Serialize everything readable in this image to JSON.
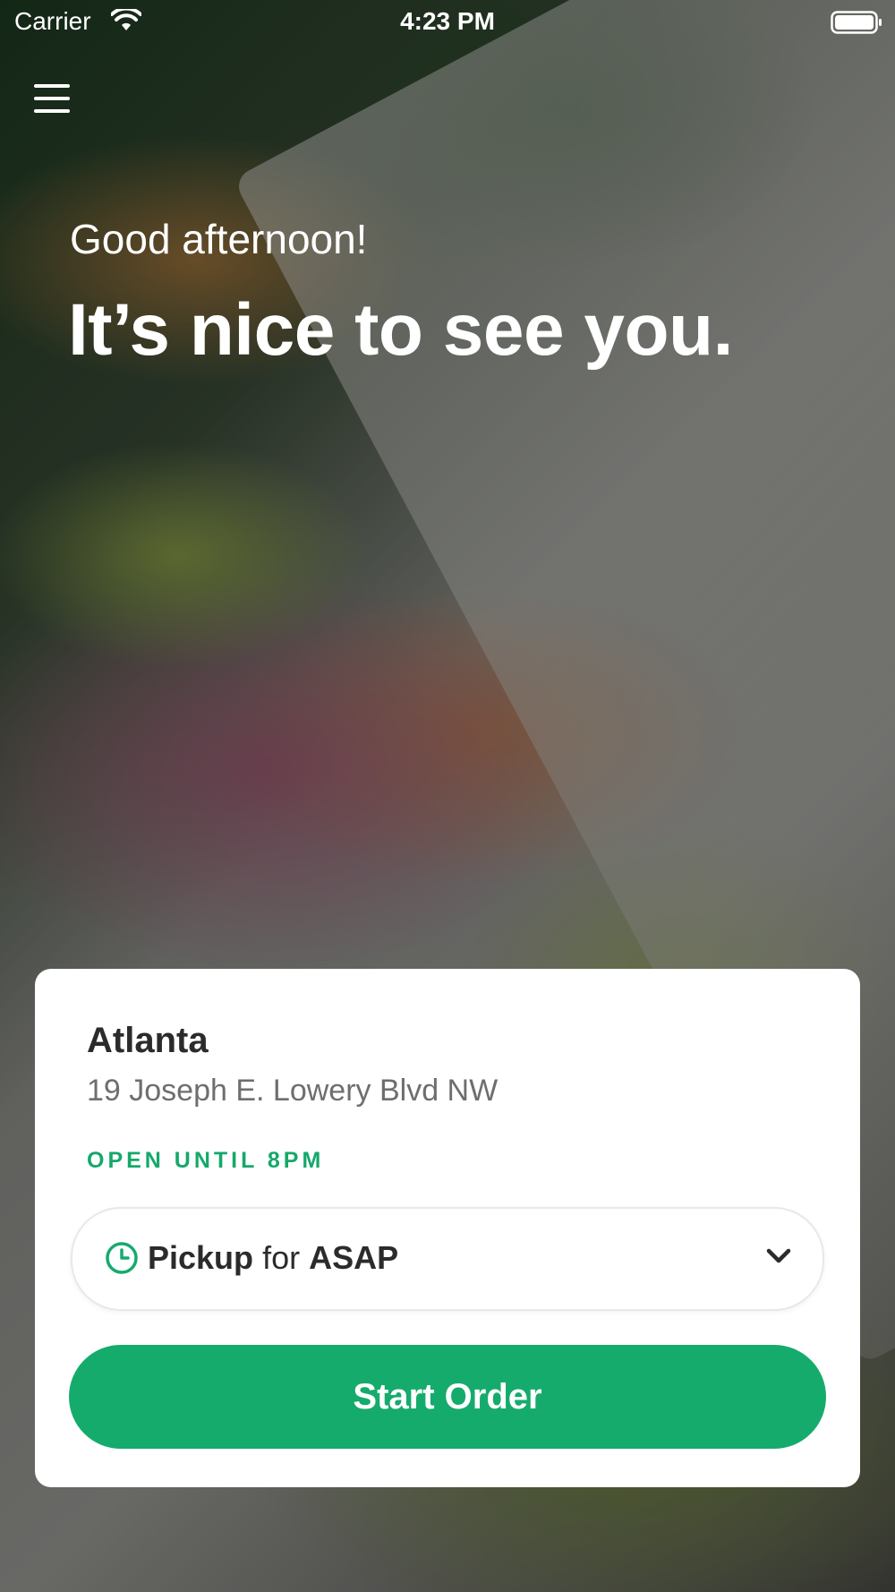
{
  "status_bar": {
    "carrier": "Carrier",
    "time": "4:23 PM",
    "wifi_icon": "wifi-icon",
    "battery_icon": "battery-icon"
  },
  "header": {
    "menu_icon": "hamburger-menu-icon",
    "greeting": "Good afternoon!",
    "headline": "It’s nice to see you."
  },
  "location_card": {
    "name": "Atlanta",
    "address": "19 Joseph E. Lowery Blvd NW",
    "open_status": "OPEN UNTIL 8PM",
    "order_mode": {
      "icon": "clock-icon",
      "mode": "Pickup",
      "connector": "for",
      "time": "ASAP",
      "dropdown_icon": "chevron-down-icon"
    },
    "start_button_label": "Start Order"
  },
  "colors": {
    "accent": "#15ab6c",
    "open_status": "#15a86b",
    "text_dark": "#2b2b2b",
    "text_muted": "#6e6e6e"
  }
}
